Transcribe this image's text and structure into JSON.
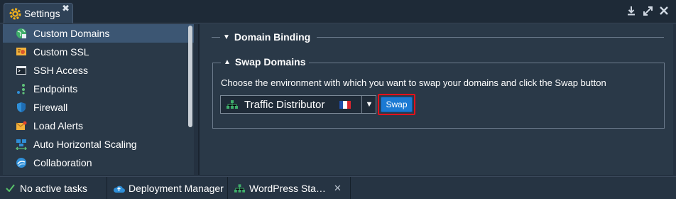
{
  "window": {
    "tab_title": "Settings",
    "tab_close": "✖"
  },
  "sidebar": {
    "items": [
      {
        "label": "Custom Domains",
        "icon": "globe-icon",
        "active": true
      },
      {
        "label": "Custom SSL",
        "icon": "certificate-icon"
      },
      {
        "label": "SSH Access",
        "icon": "terminal-icon"
      },
      {
        "label": "Endpoints",
        "icon": "endpoints-icon"
      },
      {
        "label": "Firewall",
        "icon": "shield-icon"
      },
      {
        "label": "Load Alerts",
        "icon": "alert-mail-icon"
      },
      {
        "label": "Auto Horizontal Scaling",
        "icon": "scaling-icon"
      },
      {
        "label": "Collaboration",
        "icon": "collaboration-icon"
      }
    ]
  },
  "main": {
    "domain_binding_title": "Domain Binding",
    "swap_domains_title": "Swap Domains",
    "instruction": "Choose the environment with which you want to swap your domains and click the Swap button",
    "env_select_value": "Traffic Distributor",
    "swap_button": "Swap"
  },
  "statusbar": {
    "tasks": "No active tasks",
    "deployment_manager": "Deployment Manager",
    "wordpress_tab": "WordPress Sta…",
    "close": "✕"
  },
  "colors": {
    "accent": "#1c7ad3",
    "highlight": "#e5111b",
    "active_item": "#3c5673",
    "panel": "#2a3948"
  }
}
